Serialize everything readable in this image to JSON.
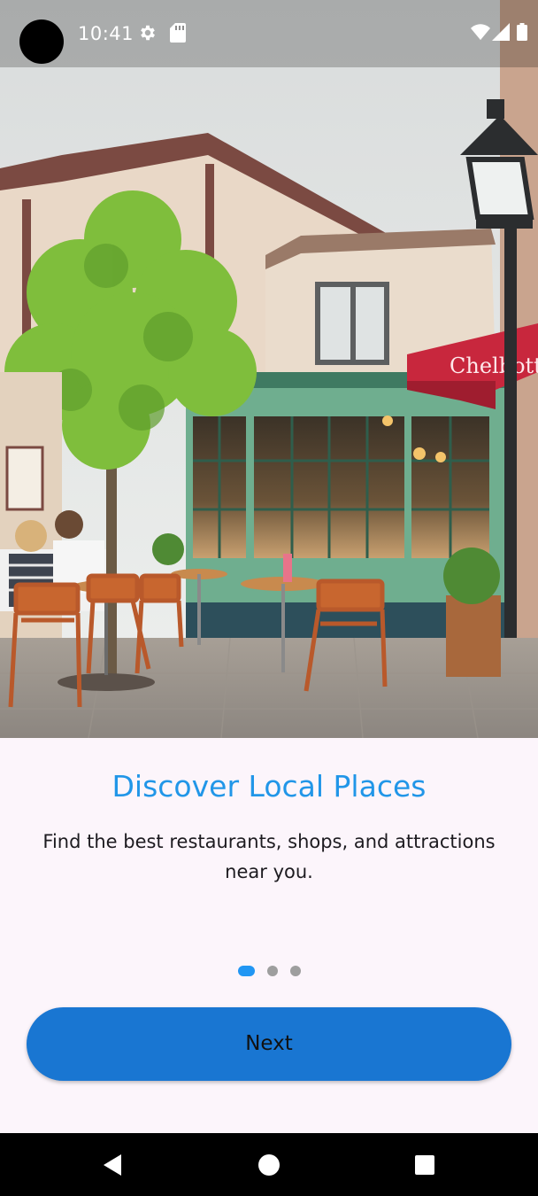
{
  "status_bar": {
    "time": "10:41",
    "left_icons": [
      "settings-icon",
      "sd-card-icon"
    ],
    "right_icons": [
      "wifi-icon",
      "cell-signal-icon",
      "battery-icon"
    ]
  },
  "hero": {
    "image": "cafe-street-photo",
    "sign_text": "Chelbotti"
  },
  "onboarding": {
    "title": "Discover Local Places",
    "description": "Find the best restaurants, shops, and attractions near you.",
    "page_indicator": {
      "total": 3,
      "current": 1
    },
    "next_label": "Next"
  },
  "nav_bar": {
    "buttons": [
      "back-icon",
      "home-icon",
      "recents-icon"
    ]
  },
  "colors": {
    "accent": "#2196e8",
    "button": "#1976d2",
    "background": "#fcf5fb",
    "dot_active": "#2196f3",
    "dot_inactive": "#9e9e9e"
  }
}
